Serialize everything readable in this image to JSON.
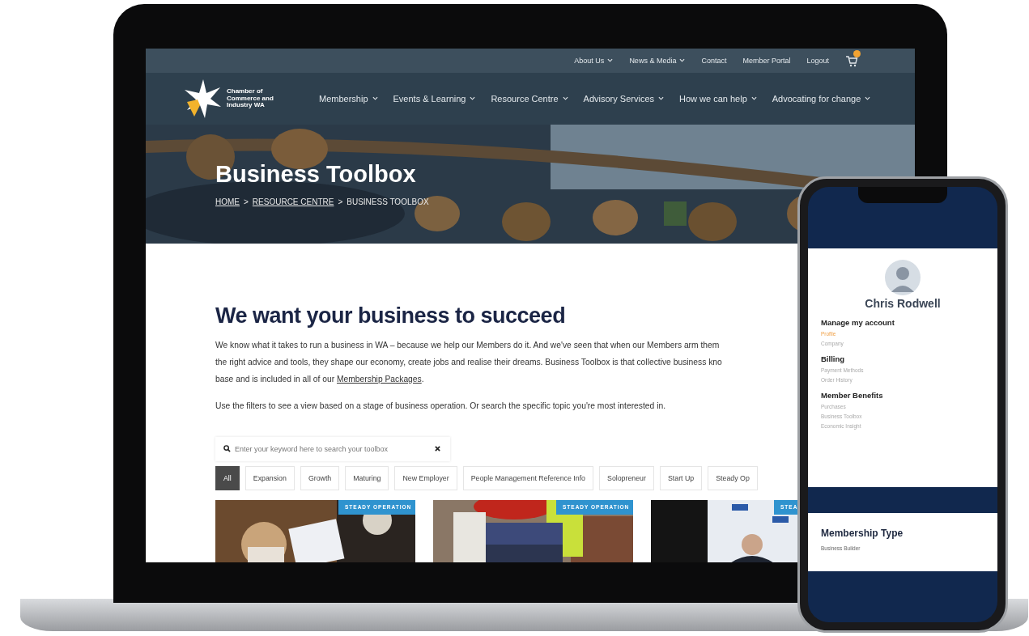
{
  "laptop": {
    "utility_nav": [
      {
        "label": "About Us",
        "dropdown": true
      },
      {
        "label": "News & Media",
        "dropdown": true
      },
      {
        "label": "Contact",
        "dropdown": false
      },
      {
        "label": "Member Portal",
        "dropdown": false
      },
      {
        "label": "Logout",
        "dropdown": false
      }
    ],
    "logo_text": "Chamber of Commerce and Industry WA",
    "main_nav": [
      {
        "label": "Membership",
        "dropdown": true
      },
      {
        "label": "Events & Learning",
        "dropdown": true
      },
      {
        "label": "Resource Centre",
        "dropdown": true
      },
      {
        "label": "Advisory Services",
        "dropdown": true
      },
      {
        "label": "How we can help",
        "dropdown": true
      },
      {
        "label": "Advocating for change",
        "dropdown": true
      }
    ],
    "hero": {
      "title": "Business Toolbox",
      "separator": ">",
      "breadcrumb": [
        {
          "label": "HOME",
          "link": true
        },
        {
          "label": "RESOURCE CENTRE",
          "link": true
        },
        {
          "label": "BUSINESS TOOLBOX",
          "link": false
        }
      ]
    },
    "heading": "We want your business to succeed",
    "intro_lines": [
      "We know what it takes to run a business in WA – because we help our Members do it. And we've seen that when our Members arm them",
      "the right advice and tools, they shape our economy, create jobs and realise their dreams. Business Toolbox is that collective business kno"
    ],
    "intro_last": "base and is included in all of our ",
    "intro_link": "Membership Packages",
    "intro_end": ".",
    "note": "Use the filters to see a view based on a stage of business operation. Or search the specific topic you're most interested in.",
    "search": {
      "placeholder": "Enter your keyword here to search your toolbox"
    },
    "filters": [
      {
        "label": "All",
        "selected": true
      },
      {
        "label": "Expansion",
        "selected": false
      },
      {
        "label": "Growth",
        "selected": false
      },
      {
        "label": "Maturing",
        "selected": false
      },
      {
        "label": "New Employer",
        "selected": false
      },
      {
        "label": "People Management Reference Info",
        "selected": false
      },
      {
        "label": "Solopreneur",
        "selected": false
      },
      {
        "label": "Start Up",
        "selected": false
      },
      {
        "label": "Steady Op",
        "selected": false
      }
    ],
    "cards": [
      {
        "badge": "STEADY OPERATION",
        "kind": "picture"
      },
      {
        "badge": "STEADY OPERATION",
        "kind": "picture"
      },
      {
        "badge": "STEA",
        "kind": "picture"
      }
    ]
  },
  "phone": {
    "name": "Chris Rodwell",
    "sections": [
      {
        "title": "Manage my account",
        "links": [
          {
            "label": "Profile",
            "selected": true
          },
          {
            "label": "Company",
            "selected": false
          }
        ]
      },
      {
        "title": "Billing",
        "links": [
          {
            "label": "Payment Methods",
            "selected": false
          },
          {
            "label": "Order History",
            "selected": false
          }
        ]
      },
      {
        "title": "Member Benefits",
        "links": [
          {
            "label": "Purchases",
            "selected": false
          },
          {
            "label": "Business Toolbox",
            "selected": false
          },
          {
            "label": "Economic Insight",
            "selected": false
          }
        ]
      }
    ],
    "membership": {
      "title": "Membership Type",
      "value": "Business Builder"
    }
  }
}
